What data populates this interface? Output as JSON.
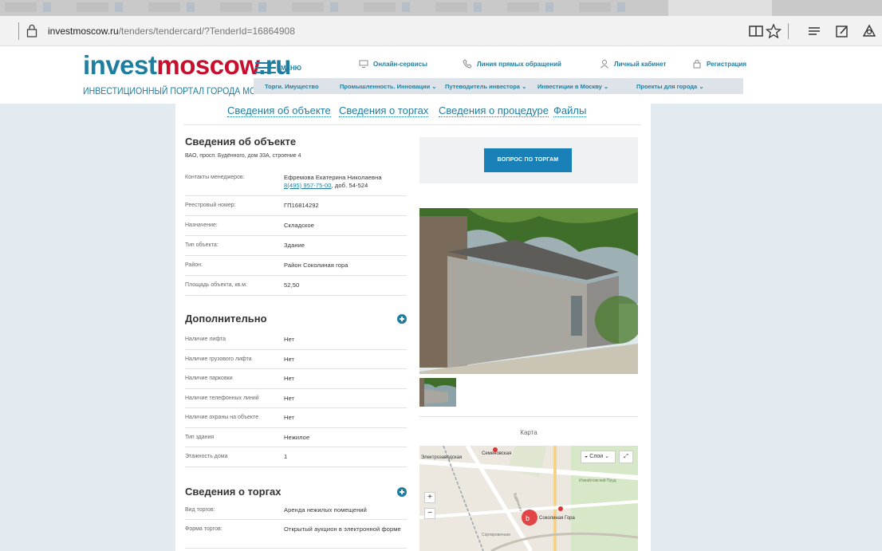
{
  "browser": {
    "url_host": "investmoscow.ru",
    "url_path": "/tenders/tendercard/?TenderId=16864908"
  },
  "header": {
    "logo_part1": "invest",
    "logo_part2": "moscow",
    "logo_part3": ".ru",
    "logo_subtitle": "ИНВЕСТИЦИОННЫЙ ПОРТАЛ ГОРОДА МОСКВЫ",
    "menu_label": "МЕНЮ",
    "top_links": {
      "online": "Онлайн-сервисы",
      "hotline": "Линия прямых обращений",
      "cabinet": "Личный кабинет",
      "register": "Регистрация"
    },
    "subnav": {
      "trade": "Торги. Имущество",
      "industry": "Промышленность. Инновации",
      "guide": "Путеводитель инвестора",
      "invest": "Инвестиции в Москву",
      "projects": "Проекты для города"
    }
  },
  "tabs": {
    "object": "Сведения об объекте",
    "trade": "Сведения о торгах",
    "procedure": "Сведения о процедуре",
    "files": "Файлы"
  },
  "object": {
    "title": "Сведения об объекте",
    "address": "ВАО, просп. Будённого, дом 33А, строение 4",
    "managers_label": "Контакты менеджеров:",
    "managers_name": "Ефремова Екатерина Николаевна",
    "managers_phone": "8(495) 957-75-00",
    "managers_ext": ", доб. 54-524",
    "rows": [
      {
        "k": "Реестровый номер:",
        "v": "ГП16814292"
      },
      {
        "k": "Назначение:",
        "v": "Складское"
      },
      {
        "k": "Тип объекта:",
        "v": "Здание"
      },
      {
        "k": "Район:",
        "v": "Район Соколиная гора"
      },
      {
        "k": "Площадь объекта, кв.м:",
        "v": "52,50"
      }
    ]
  },
  "extra": {
    "title": "Дополнительно",
    "rows": [
      {
        "k": "Наличие лифта",
        "v": "Нет"
      },
      {
        "k": "Наличие грузового лифта",
        "v": "Нет"
      },
      {
        "k": "Наличие парковки",
        "v": "Нет"
      },
      {
        "k": "Наличие телефонных линий",
        "v": "Нет"
      },
      {
        "k": "Наличие охраны на объекте",
        "v": "Нет"
      },
      {
        "k": "Тип здания",
        "v": "Нежилое"
      },
      {
        "k": "Этажность дома",
        "v": "1"
      }
    ]
  },
  "trade": {
    "title": "Сведения о торгах",
    "rows": [
      {
        "k": "Вид торгов:",
        "v": "Аренда нежилых помещений"
      },
      {
        "k": "Форма торгов:",
        "v": "Открытый аукцион в электронной форме"
      }
    ]
  },
  "aside": {
    "question_button": "ВОПРОС ПО ТОРГАМ",
    "map_label": "Карта",
    "map_layers": "Слои",
    "map_labels": {
      "semenovskaya": "Семеновская",
      "elektrozavodskaya": "Электрозаводская",
      "sokolinaya": "Соколиная Гора",
      "izmailovsky": "Измайловский Пруд",
      "sortirovochnaya": "Сортировочная",
      "budennogo": "Будённого"
    }
  }
}
